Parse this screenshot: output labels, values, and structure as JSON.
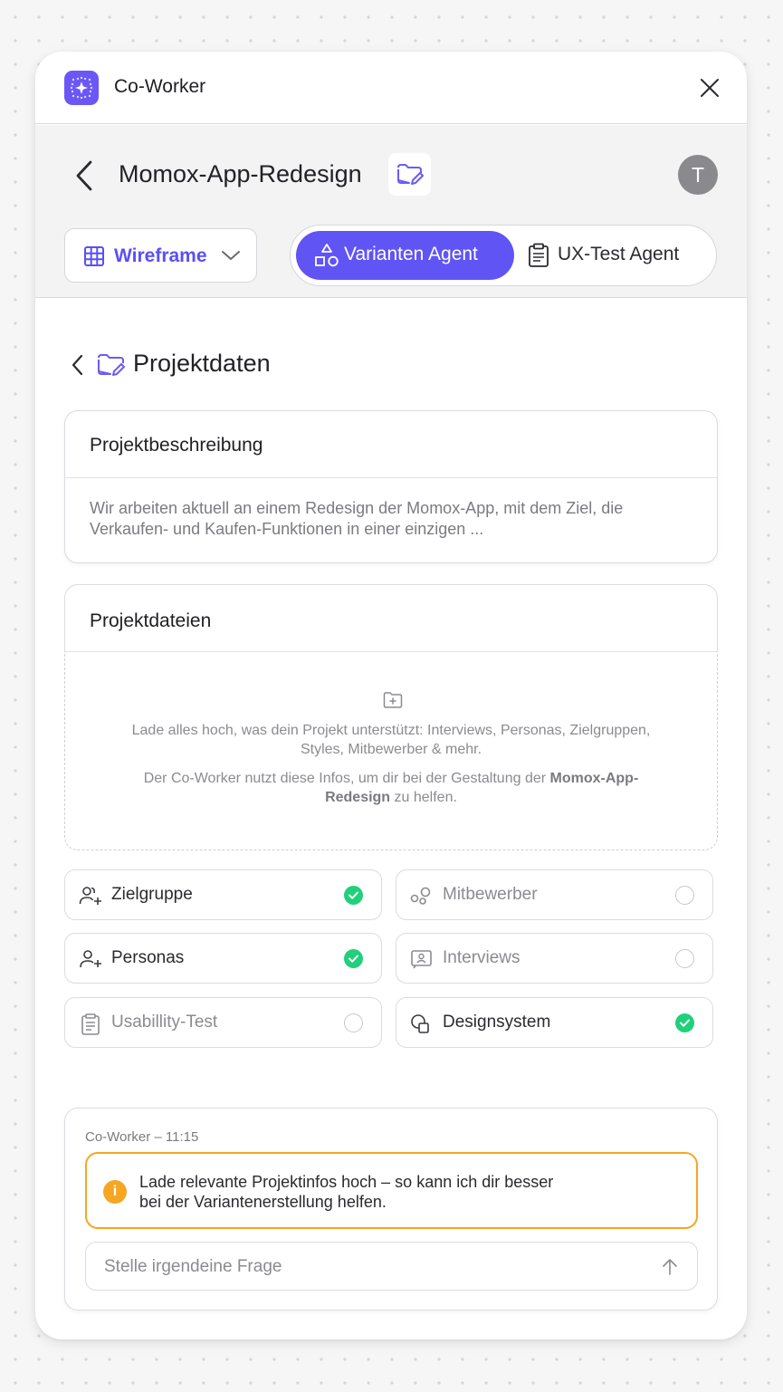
{
  "app": {
    "title": "Co-Worker"
  },
  "project": {
    "title": "Momox-App-Redesign",
    "avatar_initial": "T"
  },
  "toolbar": {
    "view_select": "Wireframe",
    "agents": [
      {
        "label": "Varianten Agent",
        "active": true
      },
      {
        "label": "UX-Test Agent",
        "active": false
      }
    ]
  },
  "section": {
    "title": "Projektdaten"
  },
  "description": {
    "heading": "Projektbeschreibung",
    "text": "Wir arbeiten aktuell an einem Redesign der Momox-App, mit dem Ziel, die Verkaufen- und Kaufen-Funktionen in einer einzigen ..."
  },
  "files": {
    "heading": "Projektdateien",
    "upload_line1": "Lade alles hoch, was dein Projekt unterstützt: Interviews, Personas, Zielgruppen, Styles, Mitbewerber & mehr.",
    "upload_line2_prefix": "Der Co-Worker nutzt diese Infos, um dir bei der Gestaltung der",
    "upload_line2_bold": "Momox-App-Redesign",
    "upload_line2_suffix": "zu helfen."
  },
  "categories": [
    {
      "label": "Zielgruppe",
      "icon": "users-plus-icon",
      "done": true
    },
    {
      "label": "Mitbewerber",
      "icon": "competitors-icon",
      "done": false
    },
    {
      "label": "Personas",
      "icon": "user-plus-icon",
      "done": true
    },
    {
      "label": "Interviews",
      "icon": "interview-icon",
      "done": false
    },
    {
      "label": "Usabillity-Test",
      "icon": "clipboard-icon",
      "done": false
    },
    {
      "label": "Designsystem",
      "icon": "shapes-icon",
      "done": true
    }
  ],
  "chat": {
    "meta": "Co-Worker – 11:15",
    "message": "Lade relevante Projektinfos hoch – so kann ich dir besser bei der Variantenerstellung helfen.",
    "input_placeholder": "Stelle irgendeine Frage"
  },
  "colors": {
    "accent": "#6054f5",
    "success": "#20d07a",
    "warning": "#f5a623"
  }
}
